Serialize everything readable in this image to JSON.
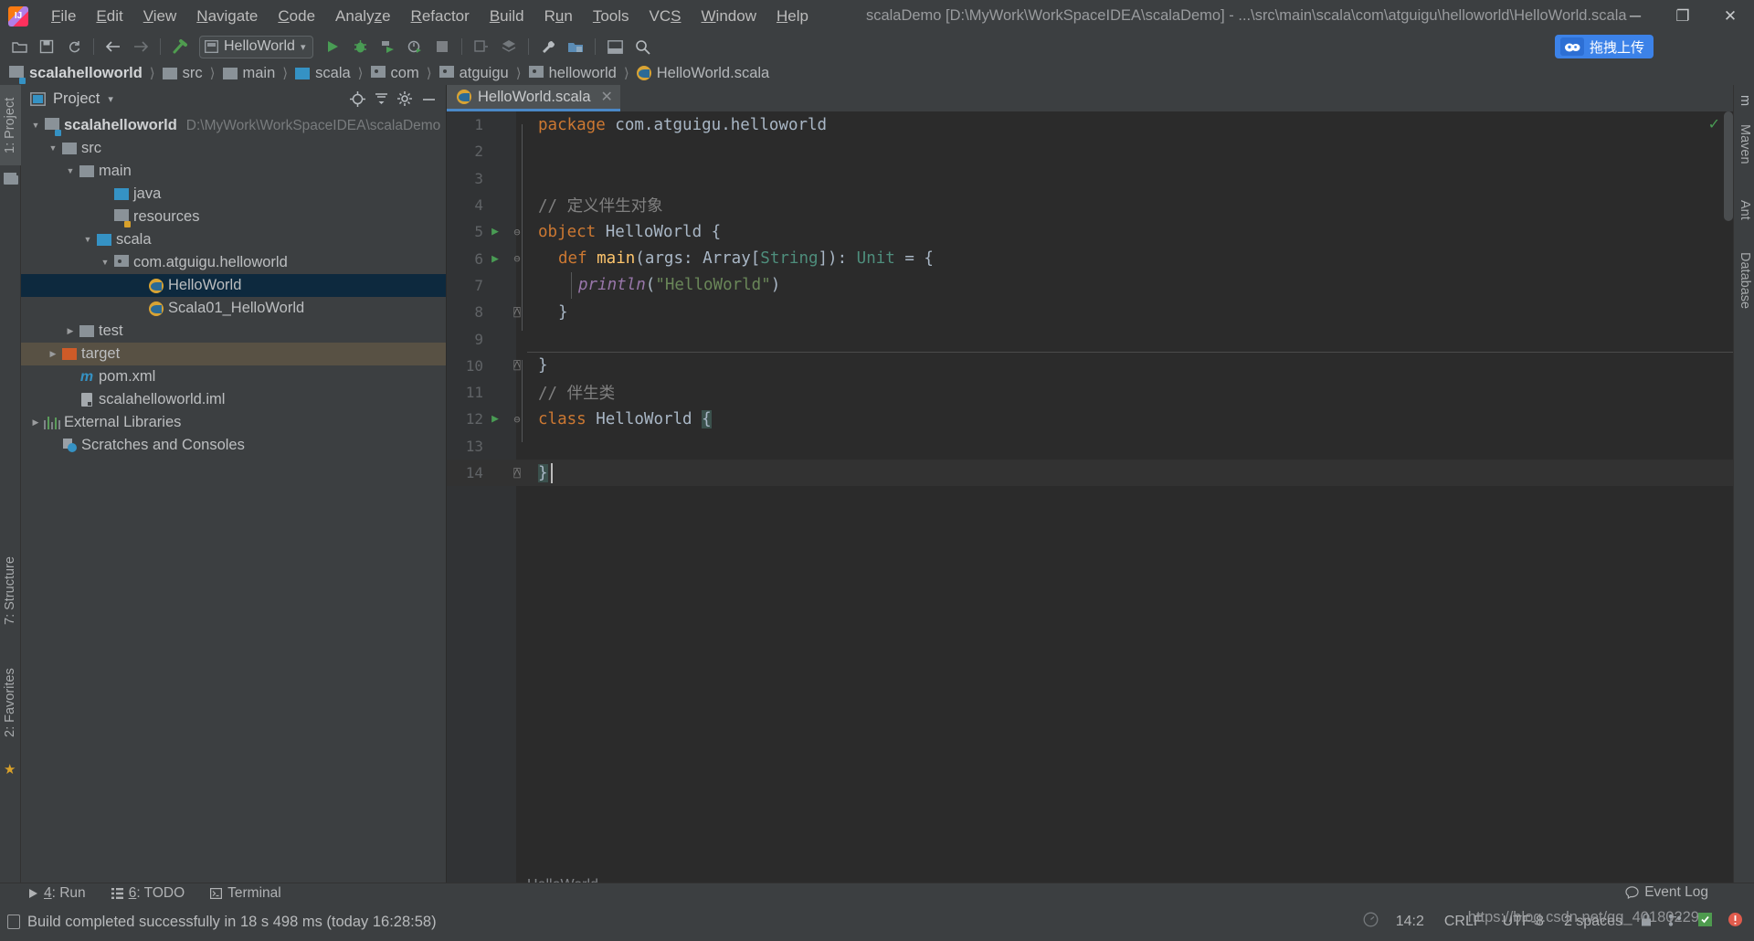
{
  "window": {
    "title": "scalaDemo [D:\\MyWork\\WorkSpaceIDEA\\scalaDemo] - ...\\src\\main\\scala\\com\\atguigu\\helloworld\\HelloWorld.scala",
    "minimize": "─",
    "maximize": "❐",
    "close": "✕"
  },
  "menu": [
    {
      "label": "File"
    },
    {
      "label": "Edit"
    },
    {
      "label": "View"
    },
    {
      "label": "Navigate"
    },
    {
      "label": "Code"
    },
    {
      "label": "Analyze"
    },
    {
      "label": "Refactor"
    },
    {
      "label": "Build"
    },
    {
      "label": "Run"
    },
    {
      "label": "Tools"
    },
    {
      "label": "VCS"
    },
    {
      "label": "Window"
    },
    {
      "label": "Help"
    }
  ],
  "toolbar": {
    "run_config": "HelloWorld",
    "dropdown_caret": "▾",
    "upload_text": "拖拽上传",
    "icons": [
      "open-folder-icon",
      "save-all-icon",
      "sync-icon",
      "back-arrow-icon",
      "forward-arrow-icon",
      "build-hammer-icon",
      "run-icon",
      "debug-icon",
      "run-coverage-icon",
      "profile-icon",
      "stop-icon",
      "attach-icon",
      "package-icon",
      "settings-wrench-icon",
      "project-structure-icon",
      "toggle-panel-icon",
      "search-everywhere-icon"
    ]
  },
  "breadcrumb": [
    {
      "label": "scalahelloworld",
      "icon": "module-folder-icon",
      "bold": true
    },
    {
      "label": "src",
      "icon": "folder-icon",
      "bold": false
    },
    {
      "label": "main",
      "icon": "folder-icon",
      "bold": false
    },
    {
      "label": "scala",
      "icon": "source-folder-icon",
      "bold": false
    },
    {
      "label": "com",
      "icon": "package-icon",
      "bold": false
    },
    {
      "label": "atguigu",
      "icon": "package-icon",
      "bold": false
    },
    {
      "label": "helloworld",
      "icon": "package-icon",
      "bold": false
    },
    {
      "label": "HelloWorld.scala",
      "icon": "scala-file-icon",
      "bold": false
    }
  ],
  "left_strip": {
    "project_tab": "1: Project",
    "structure_tab": "7: Structure",
    "favorites_tab": "2: Favorites"
  },
  "right_strip": {
    "tabs": [
      "m",
      "Maven",
      "Ant",
      "Database"
    ]
  },
  "project_panel": {
    "title": "Project",
    "caret": "▾",
    "buttons": [
      "locate-target-icon",
      "collapse-all-icon",
      "settings-gear-icon",
      "hide-panel-icon"
    ],
    "tree": [
      {
        "label": "scalahelloworld",
        "sub": "D:\\MyWork\\WorkSpaceIDEA\\scalaDemo",
        "depth": 0,
        "arrow": "▼",
        "icon": "module-folder-icon",
        "bold": true,
        "state": "normal"
      },
      {
        "label": "src",
        "sub": "",
        "depth": 1,
        "arrow": "▼",
        "icon": "folder-icon",
        "bold": false,
        "state": "normal"
      },
      {
        "label": "main",
        "sub": "",
        "depth": 2,
        "arrow": "▼",
        "icon": "folder-icon",
        "bold": false,
        "state": "normal"
      },
      {
        "label": "java",
        "sub": "",
        "depth": 3,
        "arrow": "",
        "icon": "source-folder-icon",
        "bold": false,
        "state": "normal"
      },
      {
        "label": "resources",
        "sub": "",
        "depth": 3,
        "arrow": "",
        "icon": "resources-folder-icon",
        "bold": false,
        "state": "normal"
      },
      {
        "label": "scala",
        "sub": "",
        "depth": 2,
        "arrow": "▼",
        "icon": "source-folder-icon",
        "bold": false,
        "state": "normal"
      },
      {
        "label": "com.atguigu.helloworld",
        "sub": "",
        "depth": 3,
        "arrow": "▼",
        "icon": "package-icon",
        "bold": false,
        "state": "normal"
      },
      {
        "label": "HelloWorld",
        "sub": "",
        "depth": 4,
        "arrow": "",
        "icon": "scala-file-icon",
        "bold": false,
        "state": "selected"
      },
      {
        "label": "Scala01_HelloWorld",
        "sub": "",
        "depth": 4,
        "arrow": "",
        "icon": "scala-file-icon",
        "bold": false,
        "state": "normal"
      },
      {
        "label": "test",
        "sub": "",
        "depth": 2,
        "arrow": "▶",
        "icon": "folder-icon",
        "bold": false,
        "state": "normal"
      },
      {
        "label": "target",
        "sub": "",
        "depth": 1,
        "arrow": "▶",
        "icon": "excluded-folder-icon",
        "bold": false,
        "state": "target-hl"
      },
      {
        "label": "pom.xml",
        "sub": "",
        "depth": 2,
        "arrow": "",
        "icon": "maven-icon",
        "bold": false,
        "state": "normal"
      },
      {
        "label": "scalahelloworld.iml",
        "sub": "",
        "depth": 2,
        "arrow": "",
        "icon": "iml-file-icon",
        "bold": false,
        "state": "normal"
      },
      {
        "label": "External Libraries",
        "sub": "",
        "depth": 0,
        "arrow": "▶",
        "icon": "external-libraries-icon",
        "bold": false,
        "state": "normal"
      },
      {
        "label": "Scratches and Consoles",
        "sub": "",
        "depth": 0,
        "arrow": "",
        "icon": "scratches-icon",
        "bold": false,
        "state": "normal"
      }
    ]
  },
  "editor": {
    "tab_label": "HelloWorld.scala",
    "tab_close": "✕",
    "bottom_label": "HelloWorld",
    "inspection_ok": "✓",
    "lines": [
      {
        "n": "1",
        "run": false,
        "fold": "",
        "current": false
      },
      {
        "n": "2",
        "run": false,
        "fold": "",
        "current": false
      },
      {
        "n": "3",
        "run": false,
        "fold": "",
        "current": false
      },
      {
        "n": "4",
        "run": false,
        "fold": "",
        "current": false
      },
      {
        "n": "5",
        "run": true,
        "fold": "⊖",
        "current": false
      },
      {
        "n": "6",
        "run": true,
        "fold": "⊖",
        "current": false
      },
      {
        "n": "7",
        "run": false,
        "fold": "",
        "current": false
      },
      {
        "n": "8",
        "run": false,
        "fold": "⊖",
        "current": false
      },
      {
        "n": "9",
        "run": false,
        "fold": "",
        "current": false
      },
      {
        "n": "10",
        "run": false,
        "fold": "⊖",
        "current": false
      },
      {
        "n": "11",
        "run": false,
        "fold": "",
        "current": false
      },
      {
        "n": "12",
        "run": true,
        "fold": "⊖",
        "current": false
      },
      {
        "n": "13",
        "run": false,
        "fold": "",
        "current": false
      },
      {
        "n": "14",
        "run": false,
        "fold": "⊖",
        "current": true
      }
    ],
    "code_text": {
      "l1_kw": "package",
      "l1_id": " com.atguigu.helloworld",
      "l4_comment": "// 定义伴生对象",
      "l5_kw": "object",
      "l5_name": " HelloWorld",
      "l5_brace": " {",
      "l6_kw": "def",
      "l6_fn": " main",
      "l6_p1": "(args: ",
      "l6_ty1": "Array",
      "l6_b1": "[",
      "l6_ty2": "String",
      "l6_b2": "]): ",
      "l6_ty3": "Unit",
      "l6_eq": " = {",
      "l7_fn": "println",
      "l7_p1": "(",
      "l7_str": "\"HelloWorld\"",
      "l7_p2": ")",
      "l8_brace": "}",
      "l10_brace": "}",
      "l11_comment": "// 伴生类",
      "l12_kw": "class",
      "l12_name": " HelloWorld",
      "l12_brace": "{",
      "l14_brace": "}"
    }
  },
  "toolwindow_bar": [
    {
      "label": "4: Run",
      "key": "4",
      "rest": ": Run",
      "icon": "run-icon"
    },
    {
      "label": "6: TODO",
      "key": "6",
      "rest": ": TODO",
      "icon": "todo-icon"
    },
    {
      "label": "Terminal",
      "key": "",
      "rest": "Terminal",
      "icon": "terminal-icon"
    }
  ],
  "statusbar": {
    "message": "Build completed successfully in 18 s 498 ms (today 16:28:58)",
    "event_log": "Event Log",
    "caret_position": "14:2",
    "line_separator": "CRLF",
    "encoding": "UTF-8",
    "indent": "2 spaces",
    "watermark": "https://blog.csdn.net/qq_40180229"
  },
  "colors": {
    "accent_blue": "#4a88c7",
    "selection_blue": "#0d293e",
    "keyword_orange": "#cc7832",
    "string_green": "#6a8759",
    "type_green": "#4e8e7c",
    "function_yellow": "#ffc66d",
    "comment_gray": "#808080",
    "panel_bg": "#3c3f41",
    "editor_bg": "#2b2b2b",
    "target_highlight": "#585144",
    "upload_blue": "#3c82e8"
  }
}
